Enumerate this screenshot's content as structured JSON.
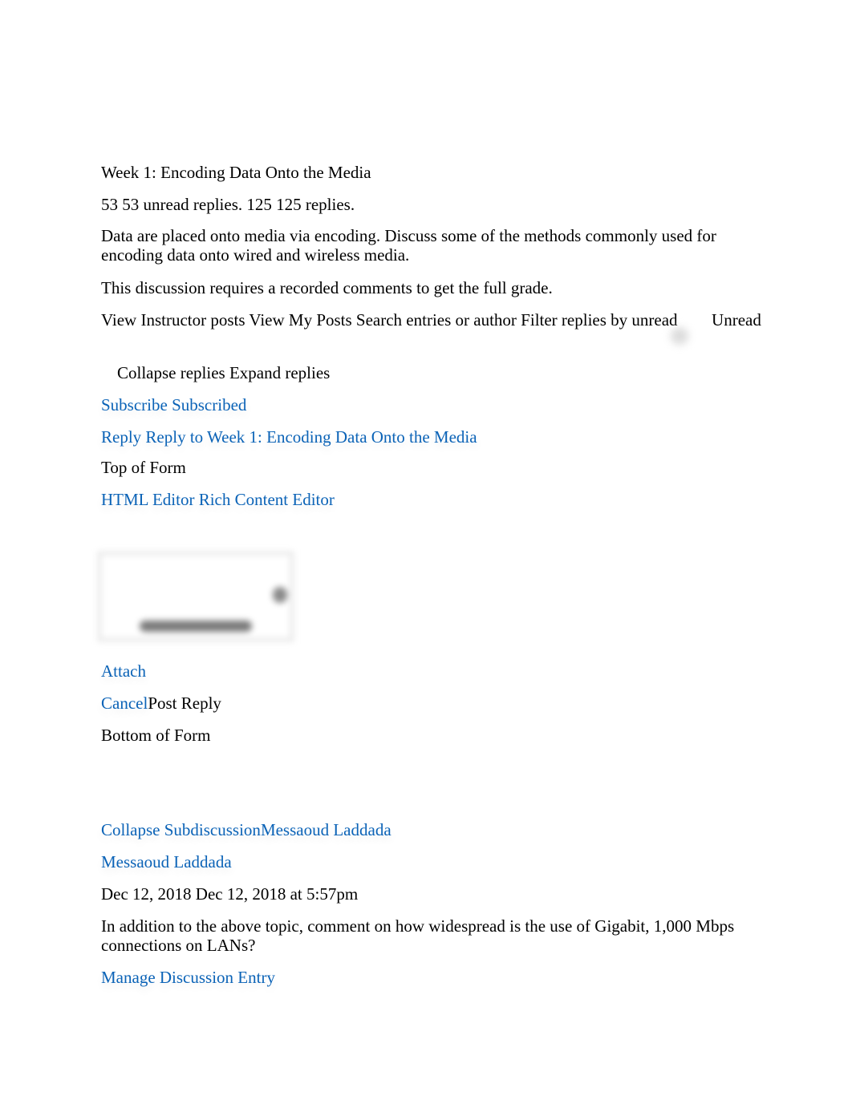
{
  "topic": {
    "title": "Week 1: Encoding Data Onto the Media",
    "counts": "53 53 unread replies. 125 125 replies.",
    "prompt": "Data are placed onto media via encoding. Discuss some of the methods commonly used for encoding data onto wired and wireless media.",
    "requirement": "This discussion requires a recorded comments to get the full grade."
  },
  "toolbar": {
    "filters_text": "View Instructor posts View My Posts Search entries or author Filter replies by unread",
    "unread_label": "Unread",
    "collapse_expand": "Collapse replies Expand replies"
  },
  "actions": {
    "subscribe": "Subscribe",
    "subscribed": "Subscribed",
    "reply": "Reply Reply to Week 1: Encoding Data Onto the Media"
  },
  "form": {
    "top_label": "Top of Form",
    "editor_switch_html": "HTML Editor",
    "editor_switch_rich": "Rich Content Editor",
    "attach": "Attach",
    "cancel": "Cancel",
    "post_reply": "Post Reply",
    "bottom_label": "Bottom of Form"
  },
  "entry": {
    "collapse_sub": "Collapse Subdiscussion",
    "collapse_author": "Messaoud Laddada",
    "author": "Messaoud Laddada",
    "date": "Dec 12, 2018 Dec 12, 2018 at 5:57pm",
    "body": "In addition to the above topic, comment on how widespread is the use of Gigabit, 1,000 Mbps connections on LANs?",
    "manage": "Manage Discussion Entry"
  }
}
